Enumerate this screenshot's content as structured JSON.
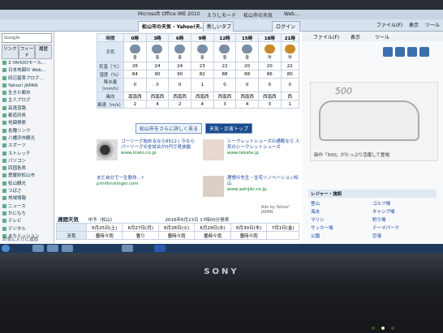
{
  "browser": {
    "title_items": [
      "Microsoft Office IME 2010",
      "えうしモード",
      "松山市の天気",
      "Web…"
    ],
    "tabs": [
      "松山市の天気 - Yahoo!天...",
      "新しいタブ",
      "ログイン"
    ],
    "commands": [
      "ファイル(F)",
      "表示",
      "ツール"
    ],
    "sidebar": {
      "search_placeholder": "Google",
      "tab_labels": [
        "リンク",
        "フィード",
        "履歴"
      ],
      "items": [
        "3.YAHOOモール…",
        "日本地図の Web…",
        "田辺基準ブログ…",
        "Yahoo! JAPAN",
        "生きた都市",
        "主人ブログ",
        "高速道路",
        "都道府県",
        "地図検索",
        "各種リンク",
        "八幡浜市観光",
        "スポーツ",
        "ストレッチ",
        "パソコン",
        "四国各県",
        "愛媛県松山市",
        "松山観光",
        "つばさ",
        "地域情報",
        "ニュース",
        "かにもち",
        "テレビ",
        "デジタル",
        "まちミッション"
      ],
      "bottom_link": "お気に入りに追加"
    }
  },
  "forecast": {
    "row_labels": {
      "time": "時間",
      "weather": "天気",
      "temp": "気温（℃）",
      "humidity": "湿度（%）",
      "rain": "降水量（mm/h）",
      "wind_dir": "風向",
      "wind_speed": "風速（m/s）"
    },
    "times": [
      "0時",
      "3時",
      "6時",
      "9時",
      "12時",
      "15時",
      "18時",
      "21時"
    ],
    "weather": [
      "曇",
      "曇",
      "曇",
      "曇",
      "曇",
      "曇",
      "晴",
      "晴"
    ],
    "temps": [
      "26",
      "24",
      "24",
      "23",
      "22",
      "20",
      "20",
      "22"
    ],
    "humidity": [
      "84",
      "90",
      "90",
      "82",
      "88",
      "88",
      "86",
      "80"
    ],
    "rain": [
      "0",
      "0",
      "0",
      "1",
      "0",
      "0",
      "0",
      "0"
    ],
    "wind_dir": [
      "南南西",
      "西南西",
      "西南西",
      "西南西",
      "西南西",
      "西南西",
      "西南西",
      "西"
    ],
    "wind_speed": [
      "2",
      "4",
      "2",
      "4",
      "3",
      "4",
      "3",
      "1"
    ]
  },
  "actions": {
    "more_detail": "松山市をさらに詳しく見る",
    "weather_top": "天気・災害トップ"
  },
  "ads": [
    {
      "text": "ゴーリーグ始めるなら8512 | 今なら パーリーグの全試合が0円で見放題",
      "url": "www.kiwlo.co.jp"
    },
    {
      "text": "シークレットシューズの通販なら 人気のシークレットシューズ",
      "url": "www.tekate.jp"
    },
    {
      "text": "まだ自分で一生懸命…?",
      "url": "printknolinger.com"
    },
    {
      "text": "理想の先生・住宅リノベーション松山",
      "url": "www.ashijiki.co.jp"
    }
  ],
  "ads_by": "Ads by Yahoo! JAPAN",
  "weekly": {
    "title": "週間天気",
    "subtitle": "中予（松山）",
    "updated": "2016年6月23日 17時00分発表",
    "dates": [
      "6月25日(土)",
      "6月27日(月)",
      "6月28日(火)",
      "6月29日(水)",
      "6月30日(木)",
      "7月1日(金)"
    ],
    "weather_label": "天気",
    "weather": [
      "曇時々雨",
      "曇り",
      "曇時々雨",
      "曇時々雨",
      "曇時々雨",
      ""
    ]
  },
  "right_panel": {
    "toolbar": [
      "ファイル(F)",
      "表示",
      "ツール"
    ],
    "car_logo": "500",
    "car_caption": "新作「500」がたっぷり活躍して登場",
    "leisure_title": "レジャー・施設",
    "leisure_items": [
      "登山",
      "ゴルフ場",
      "海水",
      "キャンプ場",
      "マリン",
      "釣り場",
      "サッカー場",
      "テーマパーク",
      "公園",
      "空港"
    ],
    "promo": "あなたに起こったモデンを使え"
  },
  "device": {
    "brand": "SONY"
  },
  "colors": {
    "accent": "#1a4b8c",
    "header": "#dde8f4",
    "link": "#1240a0",
    "taskbar": "#1f3a5c"
  }
}
